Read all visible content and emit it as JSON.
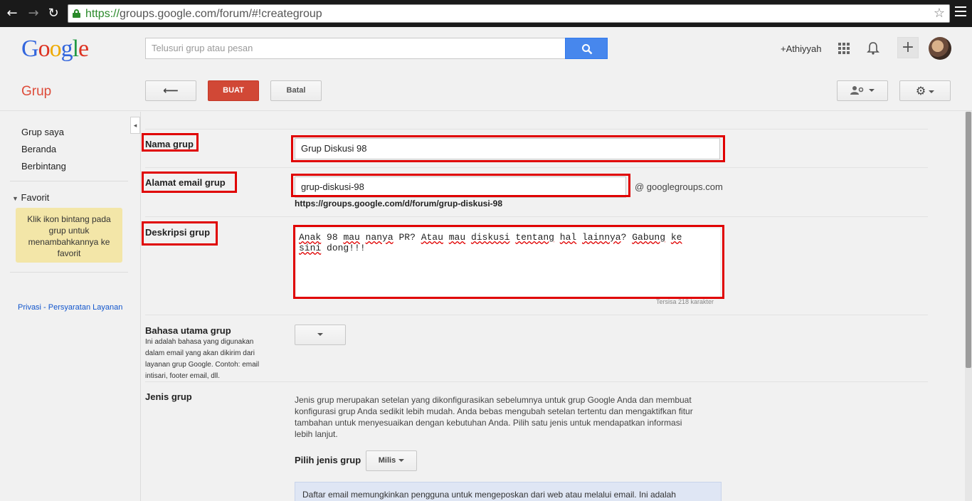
{
  "browser": {
    "url_protocol": "https://",
    "url_rest": "groups.google.com/forum/#!creategroup",
    "back_glyph": "←",
    "forward_glyph": "→",
    "reload_glyph": "↻",
    "star_glyph": "☆"
  },
  "header": {
    "logo": [
      "G",
      "o",
      "o",
      "g",
      "l",
      "e"
    ],
    "search_placeholder": "Telusuri grup atau pesan",
    "user": "+Athiyyah",
    "plus_glyph": "+"
  },
  "actionbar": {
    "app_title": "Grup",
    "back_glyph": "⟵",
    "create_label": "BUAT",
    "cancel_label": "Batal",
    "gear_glyph": "⚙"
  },
  "sidebar": {
    "items": [
      "Grup saya",
      "Beranda",
      "Berbintang"
    ],
    "favorites_header": "Favorit",
    "favorites_tip": "Klik ikon bintang pada grup untuk menambahkannya ke favorit",
    "privacy_link": "Privasi - Persyaratan Layanan",
    "collapse_glyph": "◂"
  },
  "form": {
    "name_label": "Nama grup",
    "name_value": "Grup Diskusi 98",
    "email_label": "Alamat email grup",
    "email_value": "grup-diskusi-98",
    "email_domain": "@ googlegroups.com",
    "group_url": "https://groups.google.com/d/forum/grup-diskusi-98",
    "description_label": "Deskripsi grup",
    "description_value_line1": "Anak 98 mau nanya PR? Atau mau diskusi tentang hal lainnya? Gabung ke",
    "description_value_line2": "sini dong!!!",
    "chars_left": "Tersisa 218 karakter",
    "language_label": "Bahasa utama grup",
    "language_help": "Ini adalah bahasa yang digunakan dalam email yang akan dikirim dari layanan grup Google. Contoh: email intisari, footer email, dll.",
    "type_label": "Jenis grup",
    "type_description": "Jenis grup merupakan setelan yang dikonfigurasikan sebelumnya untuk grup Google Anda dan membuat konfigurasi grup Anda sedikit lebih mudah. Anda bebas mengubah setelan tertentu dan mengaktifkan fitur tambahan untuk menyesuaikan dengan kebutuhan Anda. Pilih satu jenis untuk mendapatkan informasi lebih lanjut.",
    "choose_type_label": "Pilih jenis grup",
    "type_value": "Milis",
    "info_box_text": "Daftar email memungkinkan pengguna untuk mengeposkan dari web atau melalui email. Ini adalah"
  },
  "colors": {
    "accent_red": "#dd4b39",
    "create_button": "#d14836",
    "search_button": "#4787ed",
    "highlight_box": "#e00000"
  }
}
